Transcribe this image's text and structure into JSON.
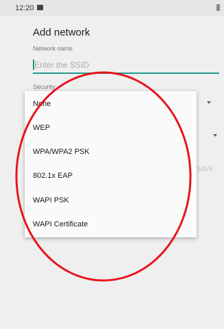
{
  "status_bar": {
    "time": "12:20"
  },
  "dialog": {
    "title": "Add network",
    "network_name_label": "Network name",
    "ssid_placeholder": "Enter the SSID",
    "security_label": "Security",
    "save_label": "SAVE"
  },
  "security_dropdown": {
    "options": [
      "None",
      "WEP",
      "WPA/WPA2 PSK",
      "802.1x EAP",
      "WAPI PSK",
      "WAPI Certificate"
    ]
  },
  "colors": {
    "accent": "#1f9a8a",
    "annotation": "#e8141c"
  }
}
